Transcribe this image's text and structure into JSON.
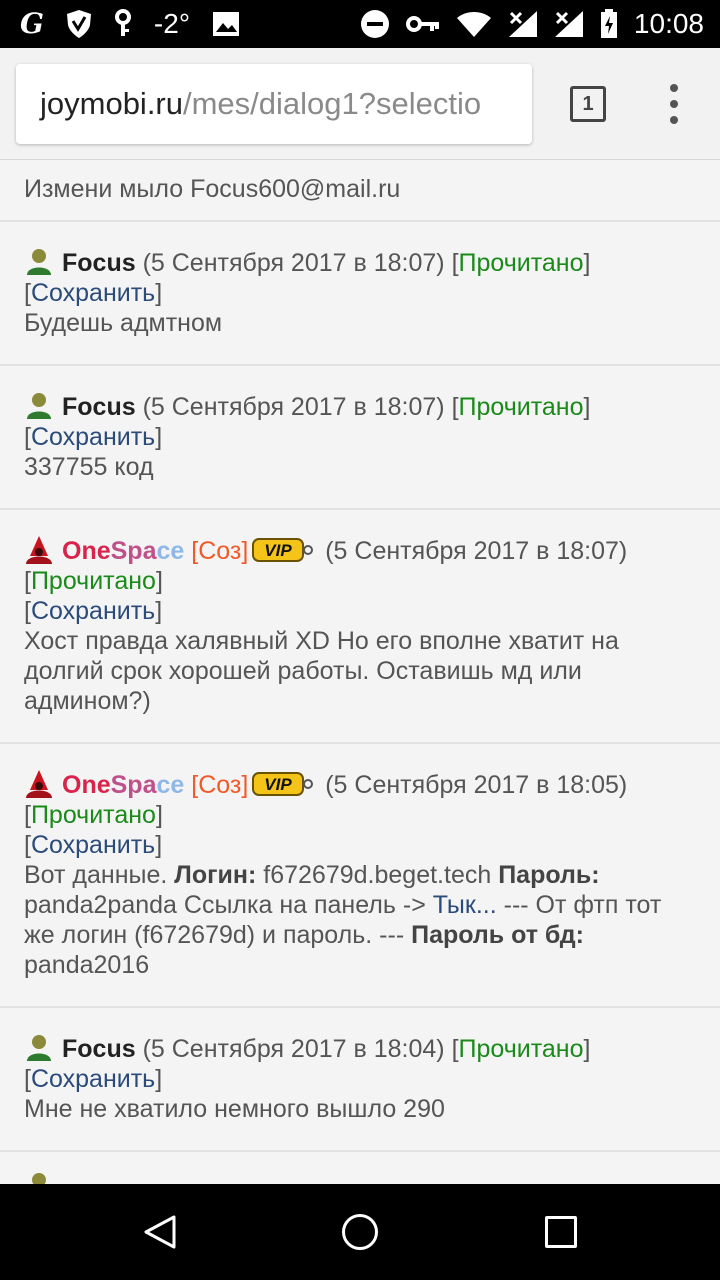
{
  "status_bar": {
    "left_icons": [
      "g-logo-icon",
      "shield-icon",
      "key-icon"
    ],
    "temperature": "-2°",
    "time": "10:08"
  },
  "browser": {
    "url_host": "joymobi.ru",
    "url_path": "/mes/dialog1?selectio",
    "tab_count": "1"
  },
  "common": {
    "read_label": "Прочитано",
    "save_label": "Сохранить",
    "role_label": "[Соз]",
    "vip_label": "VIP"
  },
  "messages": [
    {
      "body": "Измени мыло Focus600@mail.ru"
    },
    {
      "user": "Focus",
      "date": "(5 Сентября 2017 в 18:07)",
      "body": "Будешь адмтном"
    },
    {
      "user": "Focus",
      "date": "(5 Сентября 2017 в 18:07)",
      "body": "337755 код"
    },
    {
      "user_parts": [
        "One",
        "Spa",
        "ce"
      ],
      "date": "(5 Сентября 2017 в 18:07)",
      "body": "Хост правда халявный XD Но его вполне хватит на долгий срок хорошей работы. Оставишь мд или админом?)"
    },
    {
      "user_parts": [
        "One",
        "Spa",
        "ce"
      ],
      "date": "(5 Сентября 2017 в 18:05)",
      "body_parts": {
        "t1": "Вот данные. ",
        "k1": "Логин:",
        "t2": " f672679d.beget.tech ",
        "k2": "Пароль:",
        "t3": " panda2panda Ссылка на панель -> ",
        "link": "Тык...",
        "t4": " --- От фтп тот же логин (f672679d) и пароль. --- ",
        "k3": "Пароль от бд:",
        "t5": " panda2016"
      }
    },
    {
      "user": "Focus",
      "date": "(5 Сентября 2017 в 18:04)",
      "body": "Мне не хватило немного вышло 290"
    }
  ],
  "colors": {
    "read": "#1a8a1a",
    "save": "#2b4b7a",
    "role": "#f05a28",
    "vip_bg": "#f4c518"
  },
  "navbar": [
    "back-icon",
    "home-icon",
    "recent-apps-icon"
  ]
}
